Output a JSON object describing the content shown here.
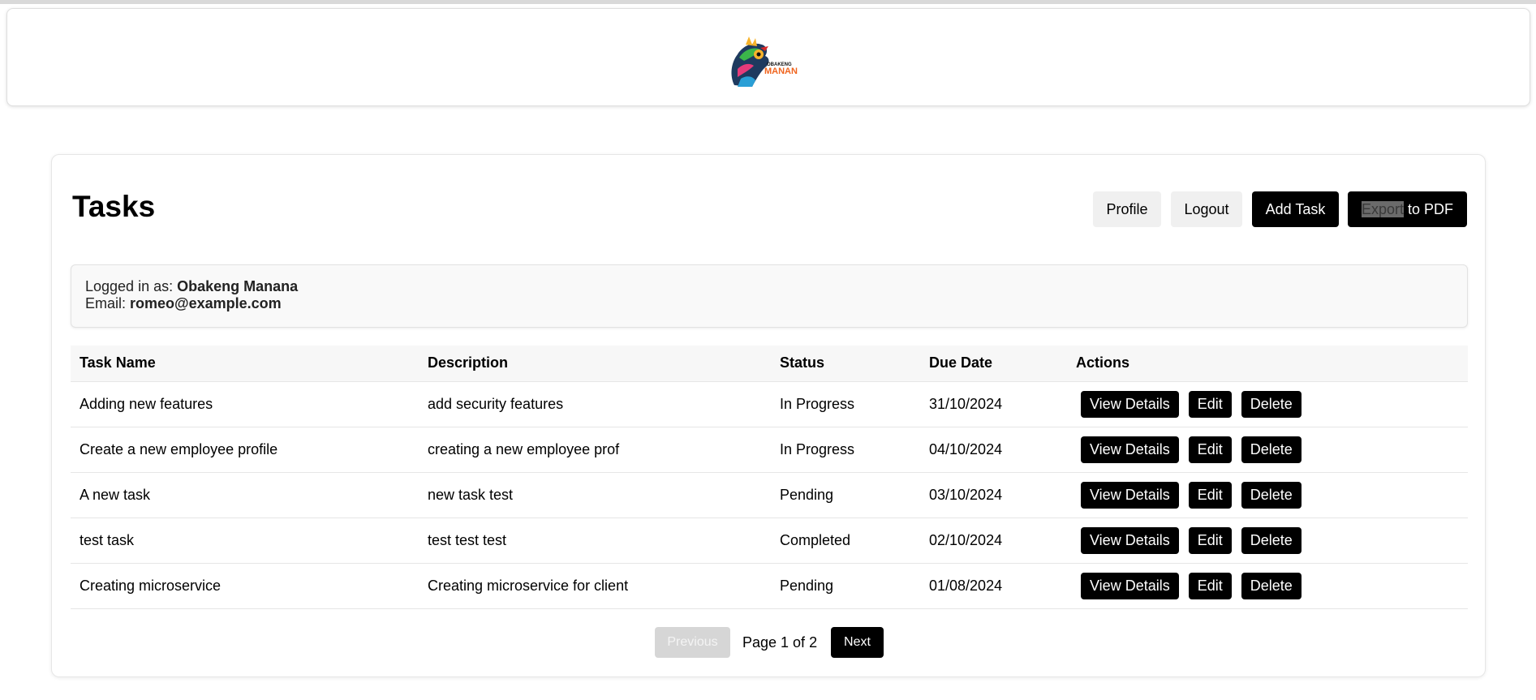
{
  "header": {
    "logo_text_top": "OBAKENG",
    "logo_text_bottom": "MANANA",
    "logo_icon": "chameleon-logo-icon",
    "colors": {
      "logo_orange": "#f0641e"
    }
  },
  "page": {
    "title": "Tasks"
  },
  "toolbar": {
    "profile_label": "Profile",
    "logout_label": "Logout",
    "add_task_label": "Add Task",
    "export_highlighted": "Export",
    "export_rest": " to PDF"
  },
  "user": {
    "logged_in_prefix": "Logged in as: ",
    "name": "Obakeng Manana",
    "email_prefix": "Email: ",
    "email": "romeo@example.com"
  },
  "table": {
    "columns": [
      "Task Name",
      "Description",
      "Status",
      "Due Date",
      "Actions"
    ],
    "rows": [
      {
        "name": "Adding new features",
        "description": "add security features",
        "status": "In Progress",
        "due": "31/10/2024"
      },
      {
        "name": "Create a new employee profile",
        "description": "creating a new employee prof",
        "status": "In Progress",
        "due": "04/10/2024"
      },
      {
        "name": "A new task",
        "description": "new task test",
        "status": "Pending",
        "due": "03/10/2024"
      },
      {
        "name": "test task",
        "description": "test test test",
        "status": "Completed",
        "due": "02/10/2024"
      },
      {
        "name": "Creating microservice",
        "description": "Creating microservice for client",
        "status": "Pending",
        "due": "01/08/2024"
      }
    ],
    "actions": {
      "view_label": "View Details",
      "edit_label": "Edit",
      "delete_label": "Delete"
    }
  },
  "pagination": {
    "previous_label": "Previous",
    "info": "Page 1 of 2",
    "next_label": "Next"
  }
}
